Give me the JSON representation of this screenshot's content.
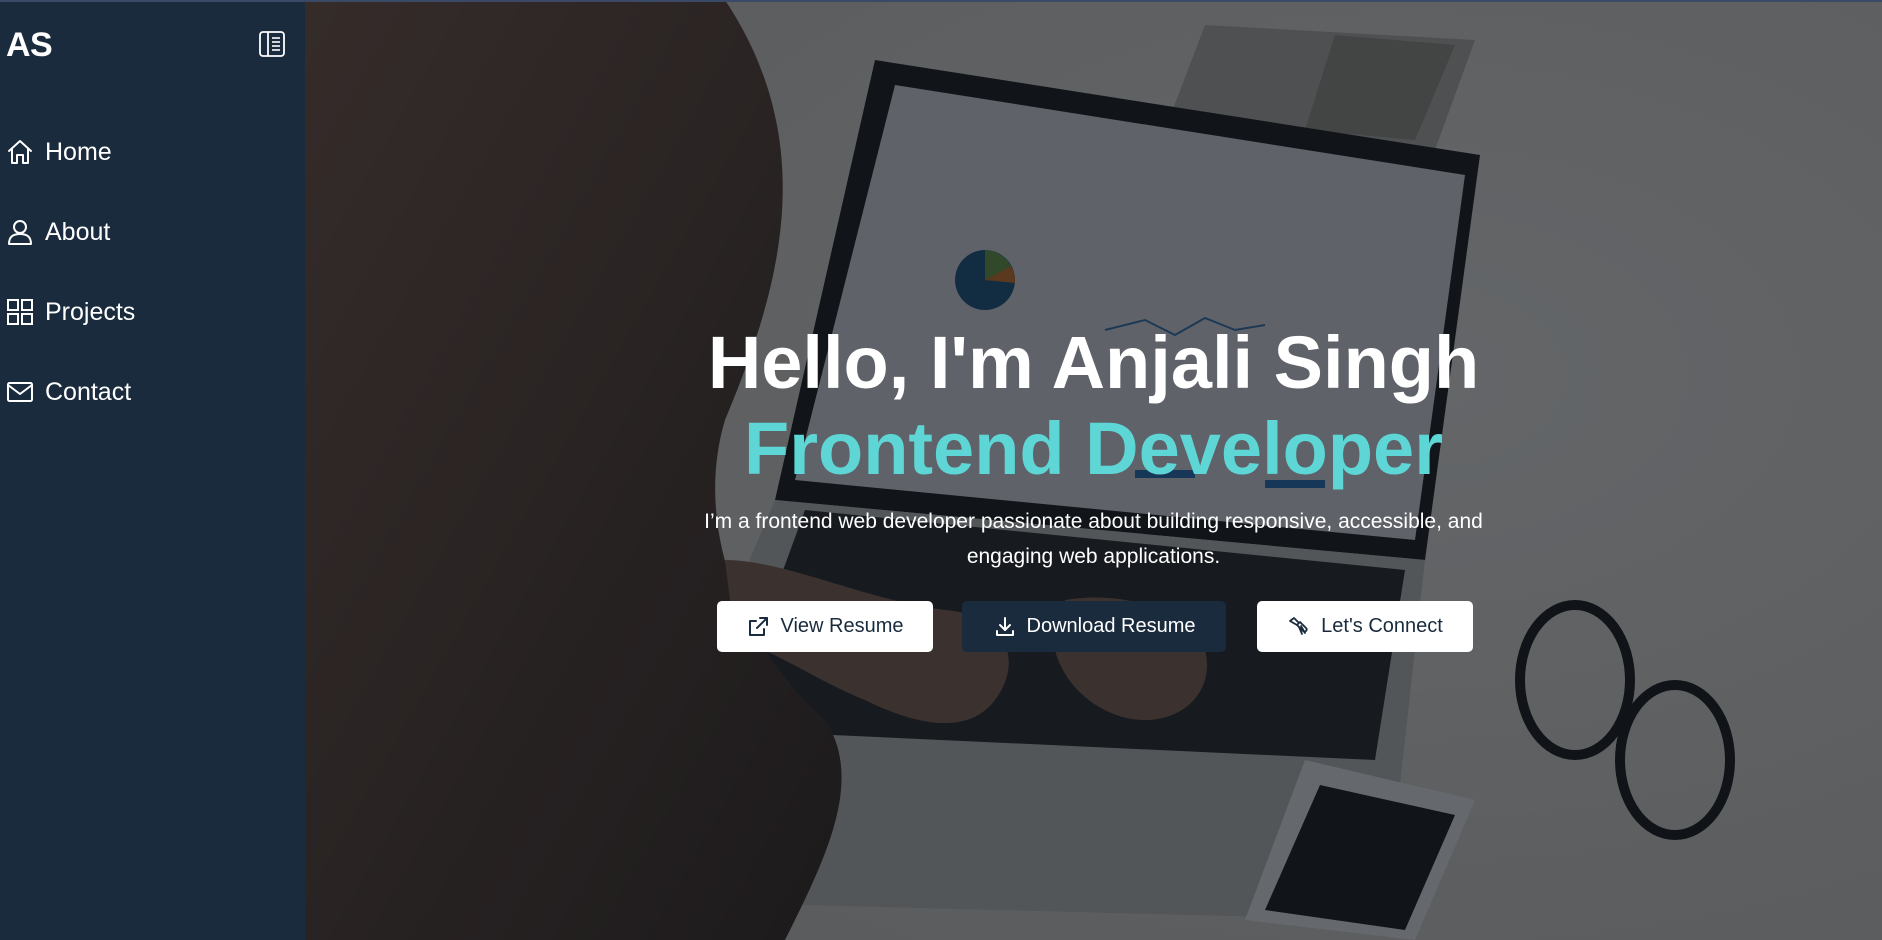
{
  "sidebar": {
    "logo": "AS",
    "items": [
      {
        "label": "Home",
        "icon": "home-icon"
      },
      {
        "label": "About",
        "icon": "user-icon"
      },
      {
        "label": "Projects",
        "icon": "grid-icon"
      },
      {
        "label": "Contact",
        "icon": "mail-icon"
      }
    ],
    "background": "#1a2b3d"
  },
  "hero": {
    "greeting": "Hello, I'm Anjali Singh",
    "role": "Frontend Developer",
    "description": "I’m a frontend web developer passionate about building responsive, accessible, and engaging web applications.",
    "buttons": {
      "view_resume": "View Resume",
      "download_resume": "Download Resume",
      "connect": "Let's Connect"
    },
    "accent": "#5ed6d6"
  }
}
